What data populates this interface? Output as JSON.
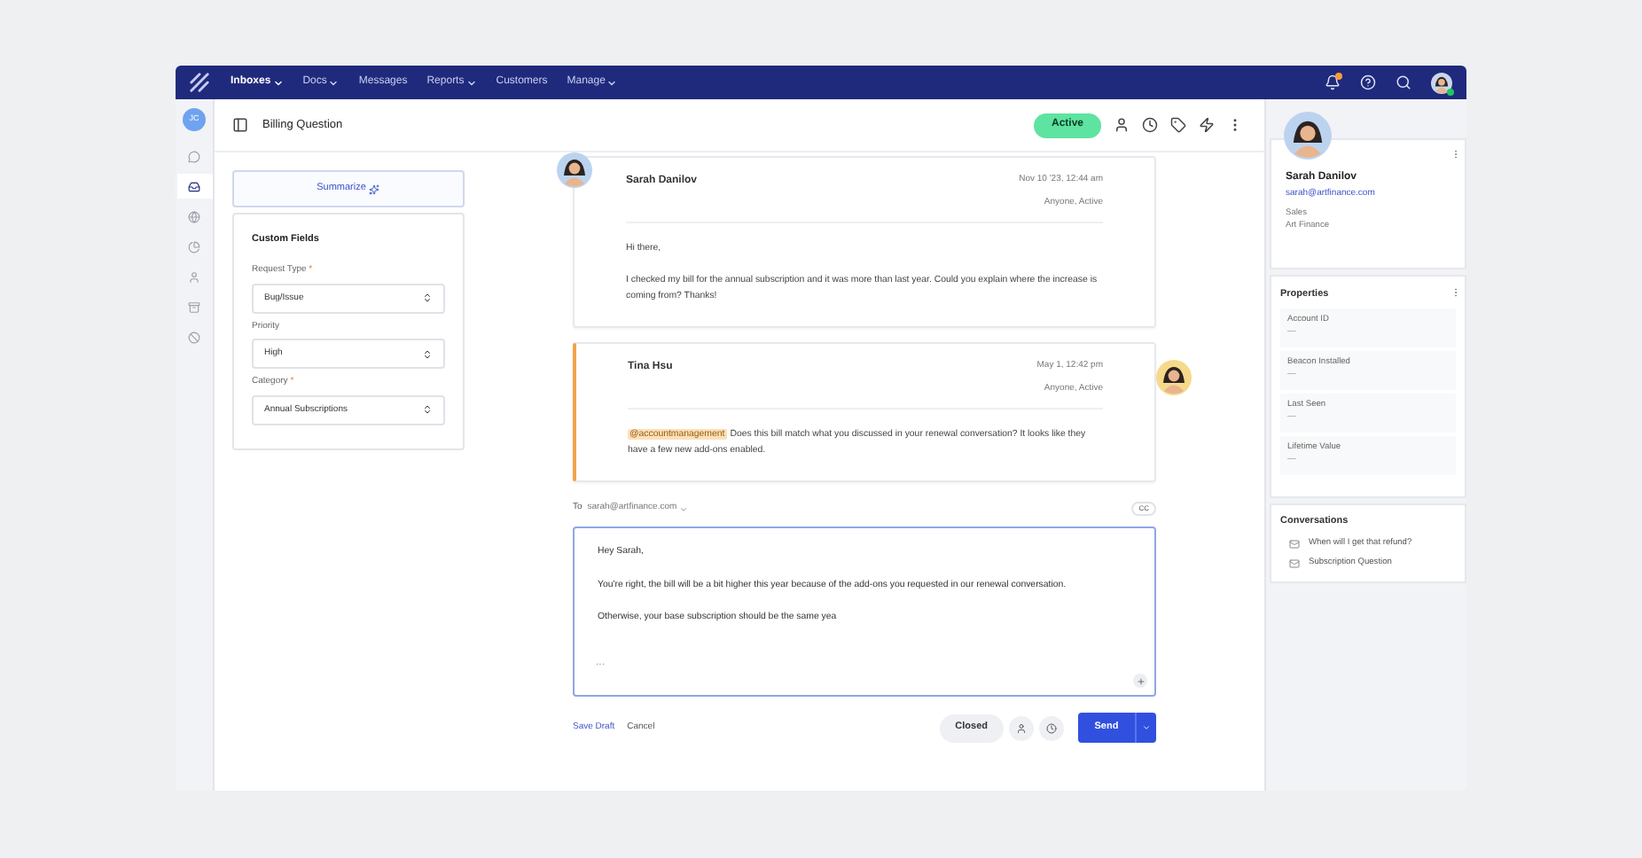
{
  "nav": {
    "items": [
      {
        "label": "Inboxes",
        "selected": true,
        "menu": true
      },
      {
        "label": "Docs",
        "selected": false,
        "menu": true
      },
      {
        "label": "Messages",
        "selected": false,
        "menu": false
      },
      {
        "label": "Reports",
        "selected": false,
        "menu": true
      },
      {
        "label": "Customers",
        "selected": false,
        "menu": false
      },
      {
        "label": "Manage",
        "selected": false,
        "menu": true
      }
    ],
    "notification": true,
    "online": true
  },
  "rail": {
    "avatar": "JC",
    "items": [
      {
        "selected": false
      },
      {
        "selected": true
      },
      {
        "selected": false
      },
      {
        "selected": false
      },
      {
        "selected": false
      },
      {
        "selected": false
      },
      {
        "selected": false
      }
    ]
  },
  "header": {
    "title": "Billing Question",
    "status": "Active"
  },
  "summarize": "Summarize",
  "custom_fields": {
    "title": "Custom Fields",
    "fields": [
      {
        "label": "Request Type",
        "marker": "*",
        "value": "Bug/Issue"
      },
      {
        "label": "Priority",
        "value": "High"
      },
      {
        "label": "Category",
        "marker": "*",
        "value": "Annual Subscriptions"
      }
    ]
  },
  "thread": [
    {
      "kind": "customer",
      "name": "Sarah Danilov",
      "time": "Nov 10 '23, 12:44 am",
      "assignee": "Anyone, Active",
      "paragraphs": [
        {
          "text": "Hi there,"
        },
        {
          "text": "I checked my bill for the annual subscription and it was more than last year. Could you explain where the increase is coming from? Thanks!"
        }
      ]
    },
    {
      "kind": "note",
      "name": "Tina Hsu",
      "time": "May 1, 12:42 pm",
      "assignee": "Anyone, Active",
      "paragraphs": [
        {
          "mention": "@accountmanagement",
          "text": "Does this bill match what you discussed in your renewal conversation? It looks like they have a few new add-ons enabled."
        }
      ]
    }
  ],
  "reply": {
    "to_label": "To",
    "recipient": "sarah@artfinance.com",
    "cc": "CC",
    "value": "Hey Sarah,\n\nYou're right, the bill will be a bit higher this year because of the add-ons you requested in our renewal conversation.\n\nOtherwise, your base subscription should be the same yea",
    "more": "···",
    "save_draft": "Save Draft",
    "cancel": "Cancel",
    "status": "Closed",
    "send": "Send"
  },
  "customer": {
    "name": "Sarah Danilov",
    "email": "sarah@artfinance.com",
    "role": "Sales",
    "company": "Art Finance",
    "properties": {
      "title": "Properties",
      "items": [
        {
          "label": "Account ID",
          "value": "—"
        },
        {
          "label": "Beacon Installed",
          "value": "—"
        },
        {
          "label": "Last Seen",
          "value": "—"
        },
        {
          "label": "Lifetime Value",
          "value": "—"
        }
      ]
    },
    "conversations": {
      "title": "Conversations",
      "items": [
        {
          "subject": "When will I get that refund?"
        },
        {
          "subject": "Subscription Question"
        }
      ]
    }
  }
}
